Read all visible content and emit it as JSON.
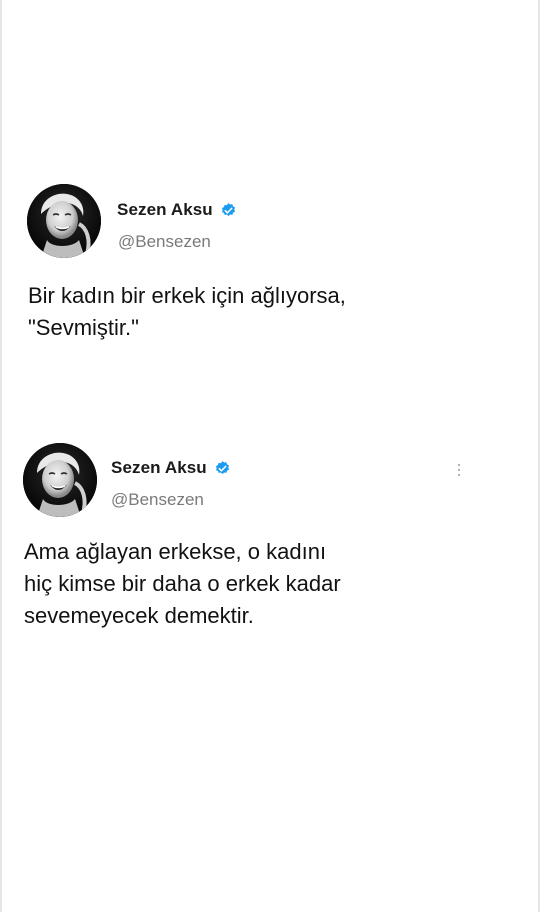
{
  "tweets": [
    {
      "display_name": "Sezen Aksu",
      "handle": "@Bensezen",
      "verified": true,
      "lines": [
        "Bir kadın bir erkek için ağlıyorsa,",
        "\"Sevmiştir.\""
      ]
    },
    {
      "display_name": "Sezen Aksu",
      "handle": "@Bensezen",
      "verified": true,
      "lines": [
        "Ama ağlayan erkekse, o kadını",
        "hiç kimse bir daha o erkek kadar",
        "sevemeyecek demektir."
      ]
    }
  ],
  "colors": {
    "verified": "#1d9bf0",
    "handle": "#7a7a7a",
    "text": "#121212"
  },
  "icons": {
    "verified": "verified-badge-icon",
    "more": "more-options-icon"
  }
}
